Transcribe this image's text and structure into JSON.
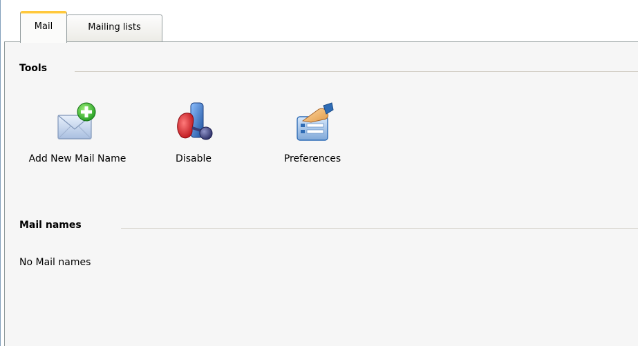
{
  "tabs": [
    {
      "label": "Mail",
      "active": true
    },
    {
      "label": "Mailing lists",
      "active": false
    }
  ],
  "tools_section": {
    "title": "Tools",
    "items": [
      {
        "label": "Add New Mail Name",
        "icon": "mail-add-icon"
      },
      {
        "label": "Disable",
        "icon": "disable-icon"
      },
      {
        "label": "Preferences",
        "icon": "preferences-icon"
      }
    ]
  },
  "mail_names_section": {
    "title": "Mail names",
    "empty_text": "No Mail names"
  },
  "colors": {
    "active_tab_accent": "#ffc83c",
    "panel_background": "#f6f6f6",
    "border": "#919b9c"
  }
}
